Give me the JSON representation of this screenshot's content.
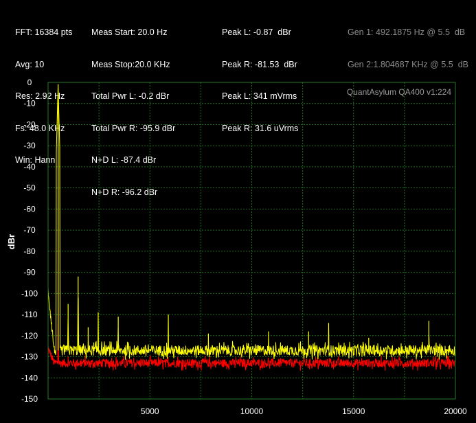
{
  "stats": {
    "col1": [
      "FFT: 16384 pts",
      "Avg: 10",
      "Res: 2.92 Hz",
      "Fs: 48.0 KHz",
      "Win: Hann"
    ],
    "col2": [
      "Meas Start: 20.0 Hz",
      "Meas Stop:20.0 KHz",
      "Total Pwr L: -0.2 dBr",
      "Total Pwr R: -95.9 dBr",
      "N+D L: -87.4 dBr",
      "N+D R: -96.2 dBr"
    ],
    "col3": [
      "Peak L: -0.87  dBr",
      "Peak R: -81.53  dBr",
      "Peak L: 341 mVrms",
      "Peak R: 31.6 uVrms"
    ],
    "gen": [
      "Gen 1: 492.1875 Hz @ 5.5  dB",
      "Gen 2:1.804687 KHz @ 5.5  dB"
    ]
  },
  "watermark": "QuantAsylum QA400 v1:224",
  "colors": {
    "background": "#000000",
    "grid": "#1f6f1f",
    "left_channel": "#ffff00",
    "right_channel": "#ff0000"
  },
  "chart_data": {
    "type": "line",
    "title": "",
    "xlabel": "",
    "ylabel": "dBr",
    "xlim": [
      0,
      20000
    ],
    "ylim": [
      -150,
      0
    ],
    "x_ticks": [
      5000,
      10000,
      15000,
      20000
    ],
    "x_tick_labels": [
      "5000",
      "10000",
      "15000",
      "20000"
    ],
    "y_ticks": [
      0,
      -10,
      -20,
      -30,
      -40,
      -50,
      -60,
      -70,
      -80,
      -90,
      -100,
      -110,
      -120,
      -130,
      -140,
      -150
    ],
    "y_tick_labels": [
      "0",
      "-10",
      "-20",
      "-30",
      "-40",
      "-50",
      "-60",
      "-70",
      "-80",
      "-90",
      "-100",
      "-110",
      "-120",
      "-130",
      "-140",
      "-150"
    ],
    "grid": true,
    "series": [
      {
        "color": "#ffff00",
        "noise_floor": -127,
        "noise_span": 5,
        "low_freq_start": -98,
        "peaks": [
          {
            "x": 492.1875,
            "y": -0.87
          },
          {
            "x": 984,
            "y": -105
          },
          {
            "x": 1476,
            "y": -92
          },
          {
            "x": 1968,
            "y": -116
          },
          {
            "x": 2460,
            "y": -109
          },
          {
            "x": 3444,
            "y": -111
          },
          {
            "x": 5904,
            "y": -110
          },
          {
            "x": 7872,
            "y": -119
          },
          {
            "x": 10824,
            "y": -118
          },
          {
            "x": 12792,
            "y": -118
          },
          {
            "x": 13776,
            "y": -114
          },
          {
            "x": 15744,
            "y": -121
          },
          {
            "x": 18696,
            "y": -113
          }
        ]
      },
      {
        "color": "#ff0000",
        "noise_floor": -133,
        "noise_span": 4,
        "low_freq_start": -126,
        "peaks": [
          {
            "x": 492.1875,
            "y": -107
          },
          {
            "x": 984,
            "y": -130
          }
        ]
      }
    ]
  }
}
